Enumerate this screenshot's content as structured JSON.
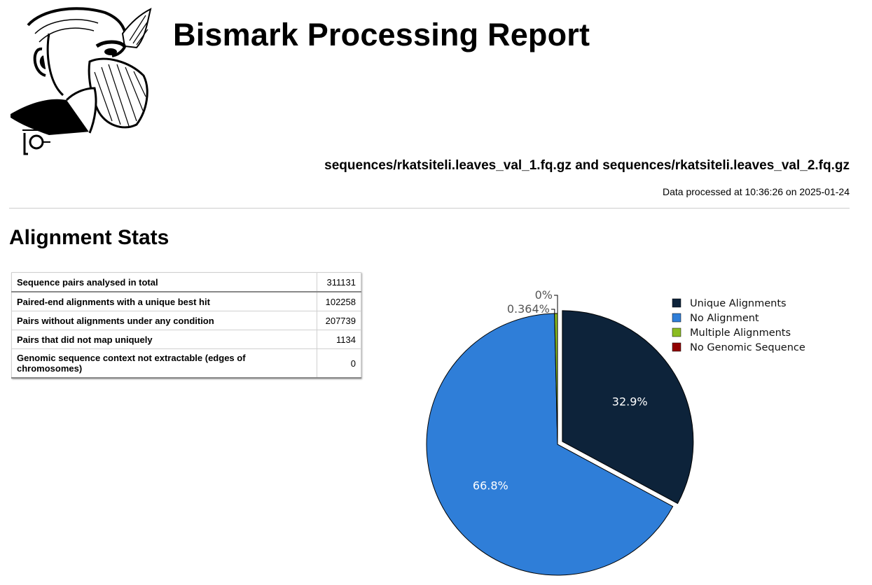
{
  "header": {
    "title": "Bismark Processing Report",
    "files": "sequences/rkatsiteli.leaves_val_1.fq.gz and sequences/rkatsiteli.leaves_val_2.fq.gz",
    "processed": "Data processed at 10:36:26 on 2025-01-24"
  },
  "section_title": "Alignment Stats",
  "stats_rows": [
    {
      "label": "Sequence pairs analysed in total",
      "value": "311131"
    },
    {
      "label": "Paired-end alignments with a unique best hit",
      "value": "102258"
    },
    {
      "label": "Pairs without alignments under any condition",
      "value": "207739"
    },
    {
      "label": "Pairs that did not map uniquely",
      "value": "1134"
    },
    {
      "label": "Genomic sequence context not extractable (edges of chromosomes)",
      "value": "0"
    }
  ],
  "chart_data": {
    "type": "pie",
    "categories": [
      "Unique Alignments",
      "No Alignment",
      "Multiple Alignments",
      "No Genomic Sequence"
    ],
    "values": [
      102258,
      207739,
      1134,
      0
    ],
    "percent_labels": [
      "32.9%",
      "66.8%",
      "0.364%",
      "0%"
    ],
    "colors": [
      "#0d233a",
      "#2f7ed8",
      "#8bbc21",
      "#910000"
    ],
    "legend_position": "top-right",
    "exploded_slice": "Unique Alignments"
  }
}
